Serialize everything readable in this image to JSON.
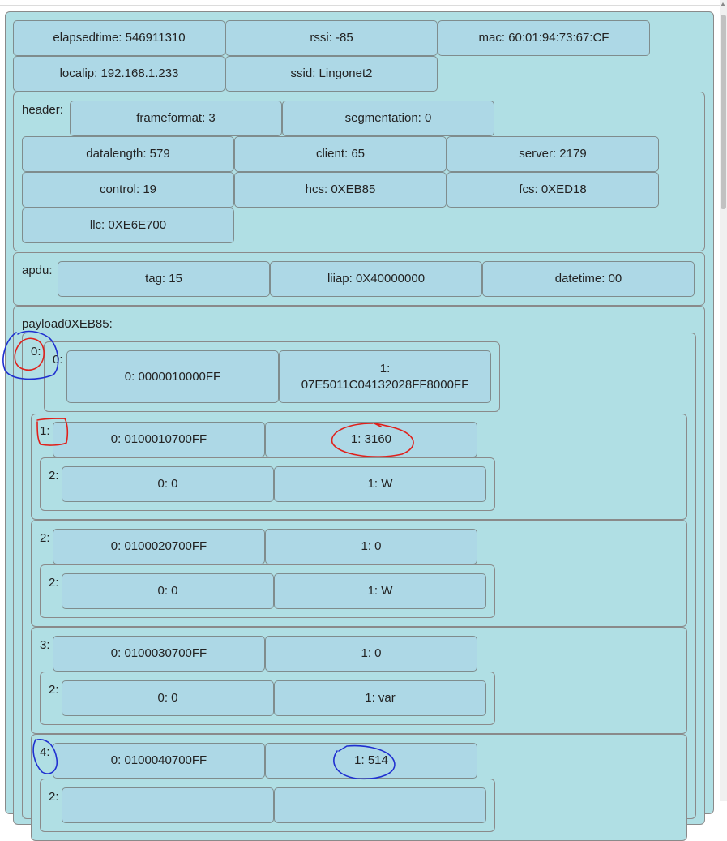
{
  "status": {
    "elapsedtime": "elapsedtime: 546911310",
    "rssi": "rssi: -85",
    "mac": "mac: 60:01:94:73:67:CF",
    "localip": "localip: 192.168.1.233",
    "ssid": "ssid: Lingonet2"
  },
  "header": {
    "label": "header:",
    "frameformat": "frameformat: 3",
    "segmentation": "segmentation: 0",
    "datalength": "datalength: 579",
    "client": "client: 65",
    "server": "server: 2179",
    "control": "control: 19",
    "hcs": "hcs: 0XEB85",
    "fcs": "fcs: 0XED18",
    "llc": "llc: 0XE6E700"
  },
  "apdu": {
    "label": "apdu:",
    "tag": "tag: 15",
    "liiap": "liiap: 0X40000000",
    "datetime": "datetime: 00"
  },
  "payload": {
    "label": "payload0XEB85:",
    "items": [
      {
        "index": "0:",
        "sub_index": "0:",
        "obis": "0: 0000010000FF",
        "value_line1": "1:",
        "value_line2": "07E5011C04132028FF8000FF"
      },
      {
        "index": "1:",
        "obis": "0: 0100010700FF",
        "value": "1: 3160",
        "sub_index": "2:",
        "scaler": "0: 0",
        "unit": "1: W"
      },
      {
        "index": "2:",
        "obis": "0: 0100020700FF",
        "value": "1: 0",
        "sub_index": "2:",
        "scaler": "0: 0",
        "unit": "1: W"
      },
      {
        "index": "3:",
        "obis": "0: 0100030700FF",
        "value": "1: 0",
        "sub_index": "2:",
        "scaler": "0: 0",
        "unit": "1: var"
      },
      {
        "index": "4:",
        "obis": "0: 0100040700FF",
        "value": "1: 514",
        "sub_index": "2:"
      }
    ]
  },
  "annotations": {
    "red": "#e0201b",
    "blue": "#1f2fd0"
  }
}
